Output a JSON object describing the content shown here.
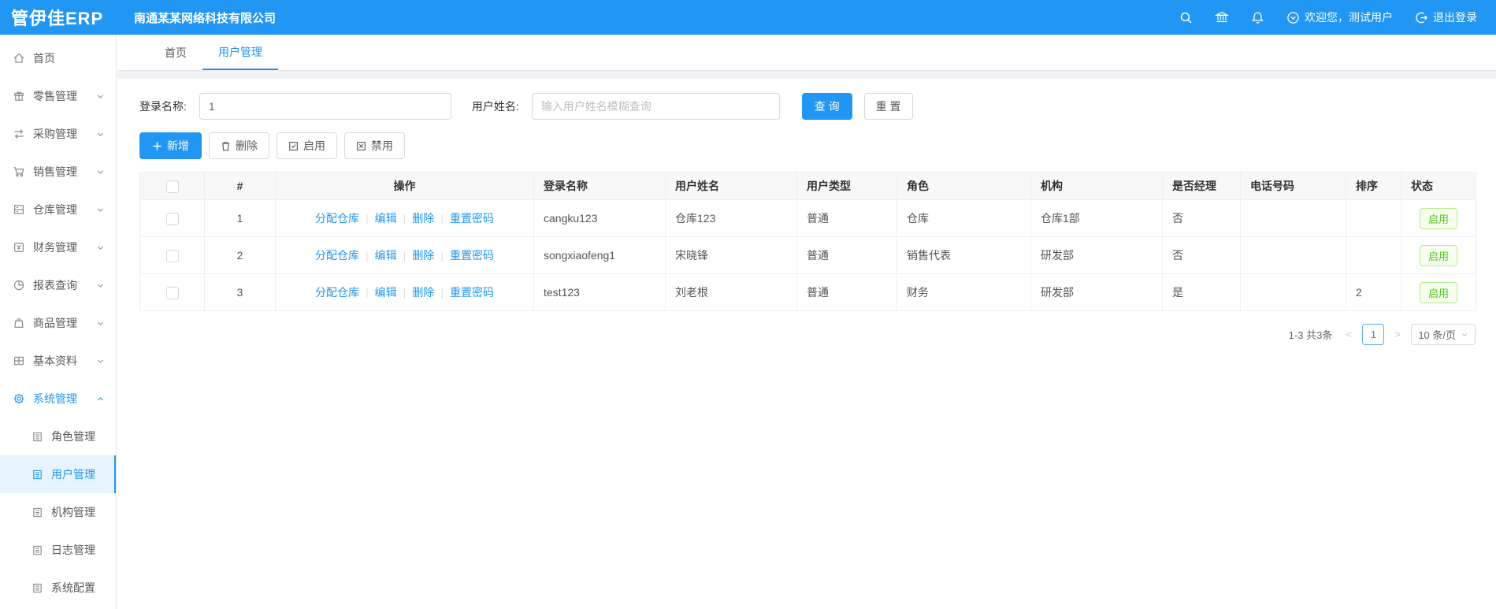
{
  "header": {
    "logo": "管伊佳ERP",
    "company": "南通某某网络科技有限公司",
    "welcome": "欢迎您，测试用户",
    "logout": "退出登录"
  },
  "tabs": [
    {
      "label": "首页"
    },
    {
      "label": "用户管理"
    }
  ],
  "sidebar": {
    "items": [
      {
        "label": "首页"
      },
      {
        "label": "零售管理"
      },
      {
        "label": "采购管理"
      },
      {
        "label": "销售管理"
      },
      {
        "label": "仓库管理"
      },
      {
        "label": "财务管理"
      },
      {
        "label": "报表查询"
      },
      {
        "label": "商品管理"
      },
      {
        "label": "基本资料"
      },
      {
        "label": "系统管理"
      }
    ],
    "system_children": [
      {
        "label": "角色管理"
      },
      {
        "label": "用户管理"
      },
      {
        "label": "机构管理"
      },
      {
        "label": "日志管理"
      },
      {
        "label": "系统配置"
      }
    ]
  },
  "search": {
    "login_label": "登录名称:",
    "login_value": "1",
    "name_label": "用户姓名:",
    "name_placeholder": "输入用户姓名模糊查询",
    "query_button": "查 询",
    "reset_button": "重 置"
  },
  "toolbar": {
    "add": "新增",
    "delete": "删除",
    "enable": "启用",
    "disable": "禁用"
  },
  "table": {
    "headers": {
      "index": "#",
      "actions": "操作",
      "login_name": "登录名称",
      "user_name": "用户姓名",
      "user_type": "用户类型",
      "role": "角色",
      "org": "机构",
      "is_manager": "是否经理",
      "phone": "电话号码",
      "sort": "排序",
      "status": "状态"
    },
    "action_labels": [
      "分配仓库",
      "编辑",
      "删除",
      "重置密码"
    ],
    "rows": [
      {
        "index": "1",
        "login_name": "cangku123",
        "user_name": "仓库123",
        "user_type": "普通",
        "role": "仓库",
        "org": "仓库1部",
        "is_manager": "否",
        "phone": "",
        "sort": "",
        "status": "启用"
      },
      {
        "index": "2",
        "login_name": "songxiaofeng1",
        "user_name": "宋晓锋",
        "user_type": "普通",
        "role": "销售代表",
        "org": "研发部",
        "is_manager": "否",
        "phone": "",
        "sort": "",
        "status": "启用"
      },
      {
        "index": "3",
        "login_name": "test123",
        "user_name": "刘老根",
        "user_type": "普通",
        "role": "财务",
        "org": "研发部",
        "is_manager": "是",
        "phone": "",
        "sort": "2",
        "status": "启用"
      }
    ]
  },
  "pagination": {
    "total": "1-3 共3条",
    "prev": "<",
    "current_page": "1",
    "next": ">",
    "page_size": "10 条/页"
  },
  "colors": {
    "primary": "#2196f3",
    "success": "#52c41a"
  }
}
